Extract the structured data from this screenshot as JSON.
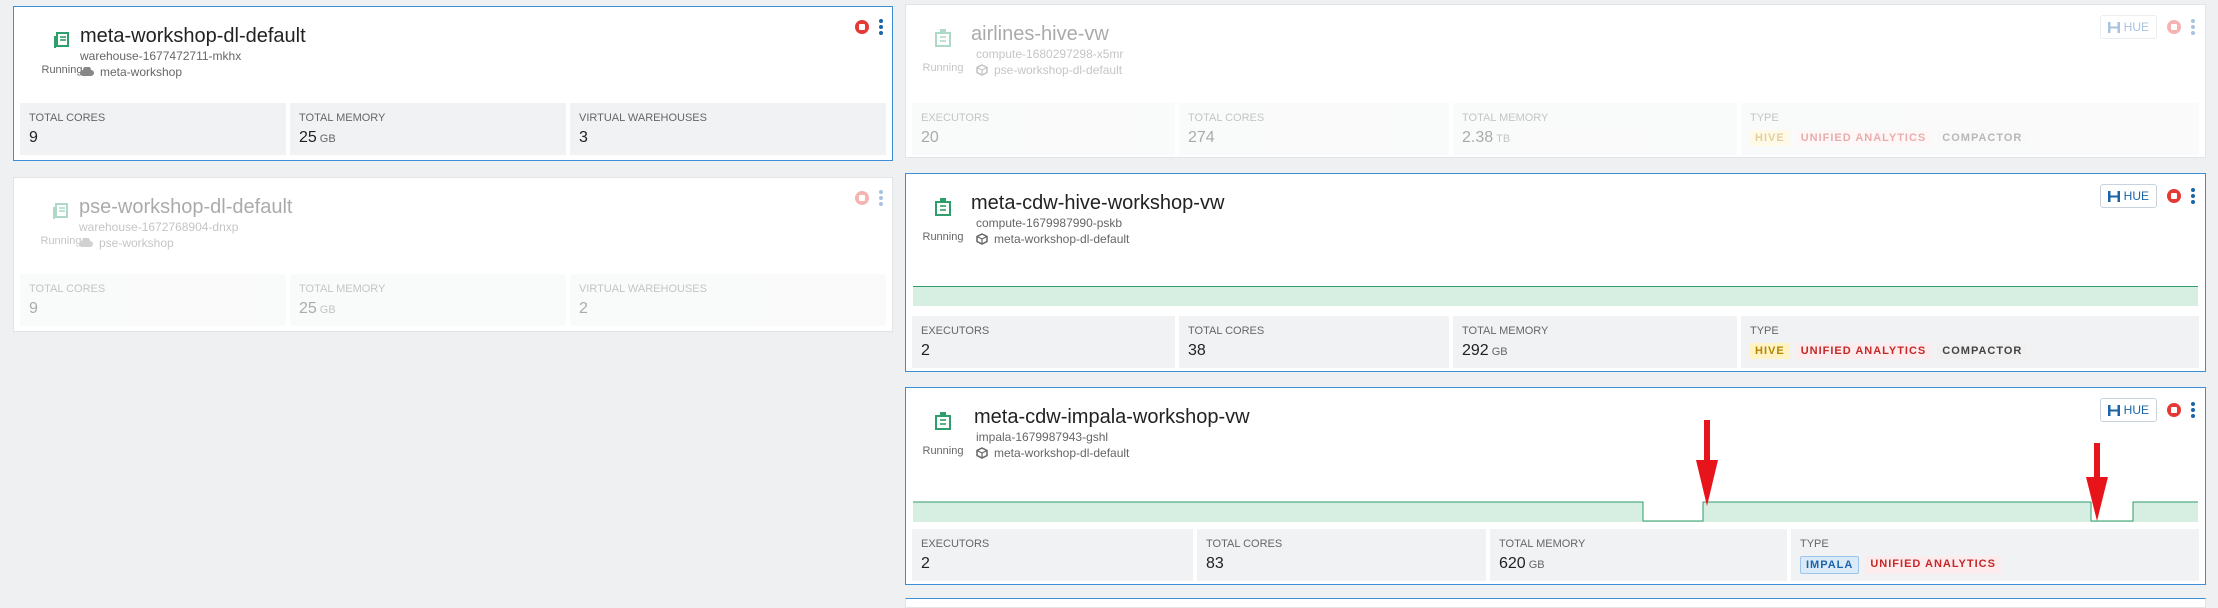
{
  "colors": {
    "accent": "#3a8fd6",
    "running": "#2e9e6b",
    "stop": "#e53935",
    "graph_fill": "#d6efe2",
    "graph_line": "#2e9e6b",
    "arrow": "#e8141b"
  },
  "env_cards": [
    {
      "status": "Running",
      "name": "meta-workshop-dl-default",
      "id": "warehouse-1677472711-mkhx",
      "env": "meta-workshop",
      "stats": [
        {
          "label": "TOTAL CORES",
          "value": "9",
          "unit": ""
        },
        {
          "label": "TOTAL MEMORY",
          "value": "25",
          "unit": "GB"
        },
        {
          "label": "VIRTUAL WAREHOUSES",
          "value": "3",
          "unit": ""
        }
      ]
    },
    {
      "status": "Running",
      "name": "pse-workshop-dl-default",
      "id": "warehouse-1672768904-dnxp",
      "env": "pse-workshop",
      "stats": [
        {
          "label": "TOTAL CORES",
          "value": "9",
          "unit": ""
        },
        {
          "label": "TOTAL MEMORY",
          "value": "25",
          "unit": "GB"
        },
        {
          "label": "VIRTUAL WAREHOUSES",
          "value": "2",
          "unit": ""
        }
      ]
    }
  ],
  "vw_cards": [
    {
      "status": "Running",
      "name": "airlines-hive-vw",
      "id": "compute-1680297298-x5mr",
      "catalog": "pse-workshop-dl-default",
      "hue": "HUE",
      "stats": [
        {
          "label": "EXECUTORS",
          "value": "20",
          "unit": ""
        },
        {
          "label": "TOTAL CORES",
          "value": "274",
          "unit": ""
        },
        {
          "label": "TOTAL MEMORY",
          "value": "2.38",
          "unit": "TB"
        }
      ],
      "type_label": "TYPE",
      "badges": [
        "HIVE",
        "UNIFIED ANALYTICS",
        "COMPACTOR"
      ]
    },
    {
      "status": "Running",
      "name": "meta-cdw-hive-workshop-vw",
      "id": "compute-1679987990-pskb",
      "catalog": "meta-workshop-dl-default",
      "hue": "HUE",
      "stats": [
        {
          "label": "EXECUTORS",
          "value": "2",
          "unit": ""
        },
        {
          "label": "TOTAL CORES",
          "value": "38",
          "unit": ""
        },
        {
          "label": "TOTAL MEMORY",
          "value": "292",
          "unit": "GB"
        }
      ],
      "type_label": "TYPE",
      "badges": [
        "HIVE",
        "UNIFIED ANALYTICS",
        "COMPACTOR"
      ]
    },
    {
      "status": "Running",
      "name": "meta-cdw-impala-workshop-vw",
      "id": "impala-1679987943-gshl",
      "catalog": "meta-workshop-dl-default",
      "hue": "HUE",
      "stats": [
        {
          "label": "EXECUTORS",
          "value": "2",
          "unit": ""
        },
        {
          "label": "TOTAL CORES",
          "value": "83",
          "unit": ""
        },
        {
          "label": "TOTAL MEMORY",
          "value": "620",
          "unit": "GB"
        }
      ],
      "type_label": "TYPE",
      "badges": [
        "IMPALA",
        "UNIFIED ANALYTICS"
      ]
    }
  ]
}
